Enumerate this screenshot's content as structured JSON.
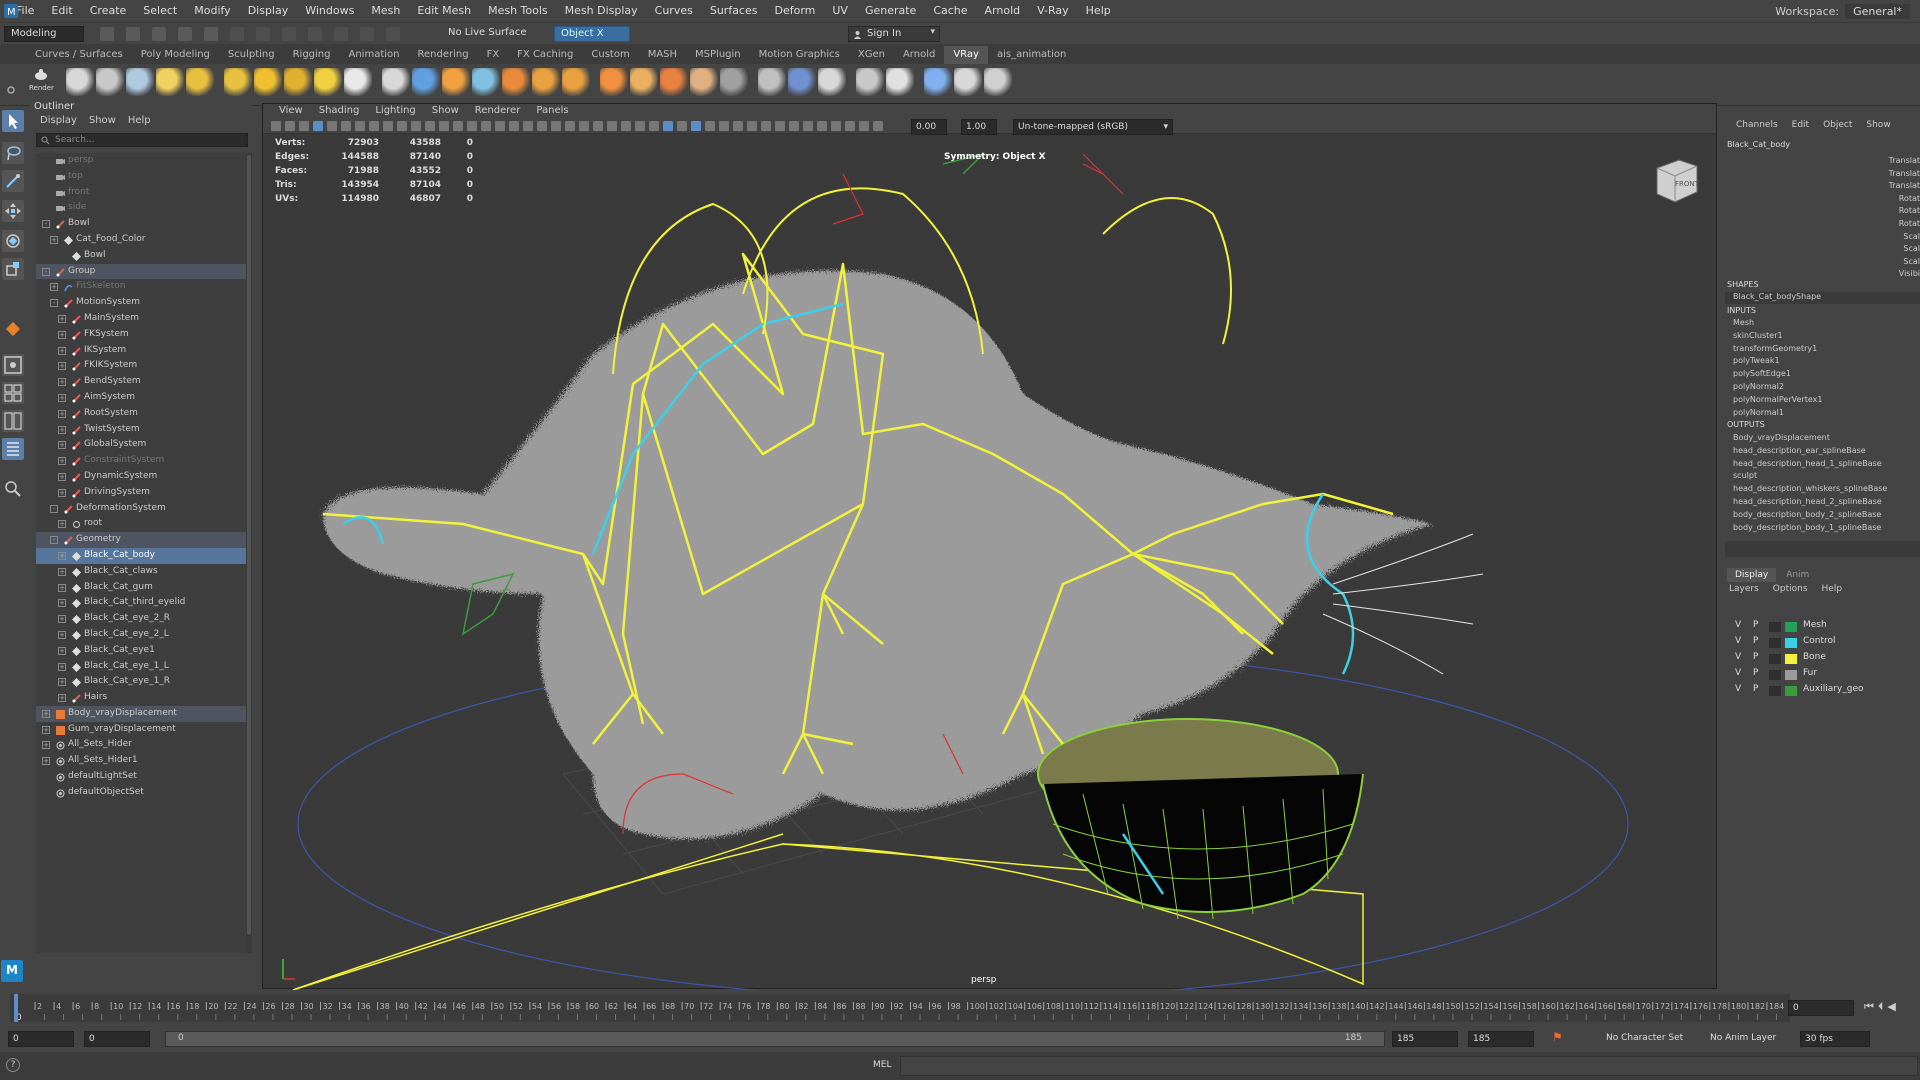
{
  "menubar": {
    "items": [
      "File",
      "Edit",
      "Create",
      "Select",
      "Modify",
      "Display",
      "Windows",
      "Mesh",
      "Edit Mesh",
      "Mesh Tools",
      "Mesh Display",
      "Curves",
      "Surfaces",
      "Deform",
      "UV",
      "Generate",
      "Cache",
      "Arnold",
      "V-Ray",
      "Help"
    ],
    "workspace_label": "Workspace:",
    "workspace_value": "General*"
  },
  "statusline": {
    "mode": "Modeling",
    "live_surface": "No Live Surface",
    "symmetry": "Object X",
    "sign_in": "Sign In"
  },
  "shelf": {
    "tabs": [
      "Curves / Surfaces",
      "Poly Modeling",
      "Sculpting",
      "Rigging",
      "Animation",
      "Rendering",
      "FX",
      "FX Caching",
      "Custom",
      "MASH",
      "MSPlugin",
      "Motion Graphics",
      "XGen",
      "Arnold",
      "VRay",
      "ais_animation"
    ],
    "active_tab": "VRay",
    "render_label": "Render"
  },
  "colors": {
    "selection": "#56779b",
    "mesh": "#23a05a",
    "control": "#3bd0e8",
    "bone": "#f2f23c",
    "fur": "#9b9b9b",
    "auxiliary": "#3c9b3c"
  },
  "outliner": {
    "title": "Outliner",
    "menu": [
      "Display",
      "Show",
      "Help"
    ],
    "search_placeholder": "Search...",
    "rows": [
      {
        "label": "persp",
        "depth": 1,
        "icon": "camera-icon",
        "dim": true
      },
      {
        "label": "top",
        "depth": 1,
        "icon": "camera-icon",
        "dim": true
      },
      {
        "label": "front",
        "depth": 1,
        "icon": "camera-icon",
        "dim": true
      },
      {
        "label": "side",
        "depth": 1,
        "icon": "camera-icon",
        "dim": true
      },
      {
        "label": "Bowl",
        "depth": 1,
        "icon": "joint-icon",
        "exp": "-"
      },
      {
        "label": "Cat_Food_Color",
        "depth": 2,
        "icon": "mesh-icon",
        "exp": "+"
      },
      {
        "label": "Bowl",
        "depth": 3,
        "icon": "mesh-icon"
      },
      {
        "label": "Group",
        "depth": 1,
        "icon": "joint-icon",
        "exp": "-",
        "grp": true
      },
      {
        "label": "FitSkeleton",
        "depth": 2,
        "icon": "curve-icon",
        "exp": "+",
        "dim": true
      },
      {
        "label": "MotionSystem",
        "depth": 2,
        "icon": "joint-icon",
        "exp": "-"
      },
      {
        "label": "MainSystem",
        "depth": 3,
        "icon": "joint-icon",
        "exp": "+"
      },
      {
        "label": "FKSystem",
        "depth": 3,
        "icon": "joint-icon",
        "exp": "+"
      },
      {
        "label": "IKSystem",
        "depth": 3,
        "icon": "joint-icon",
        "exp": "+"
      },
      {
        "label": "FKIKSystem",
        "depth": 3,
        "icon": "joint-icon",
        "exp": "+"
      },
      {
        "label": "BendSystem",
        "depth": 3,
        "icon": "joint-icon",
        "exp": "+"
      },
      {
        "label": "AimSystem",
        "depth": 3,
        "icon": "joint-icon",
        "exp": "+"
      },
      {
        "label": "RootSystem",
        "depth": 3,
        "icon": "joint-icon",
        "exp": "+"
      },
      {
        "label": "TwistSystem",
        "depth": 3,
        "icon": "joint-icon",
        "exp": "+"
      },
      {
        "label": "GlobalSystem",
        "depth": 3,
        "icon": "joint-icon",
        "exp": "+"
      },
      {
        "label": "ConstraintSystem",
        "depth": 3,
        "icon": "joint-icon",
        "exp": "+",
        "dim": true
      },
      {
        "label": "DynamicSystem",
        "depth": 3,
        "icon": "joint-icon",
        "exp": "+"
      },
      {
        "label": "DrivingSystem",
        "depth": 3,
        "icon": "joint-icon",
        "exp": "+"
      },
      {
        "label": "DeformationSystem",
        "depth": 2,
        "icon": "joint-icon",
        "exp": "-"
      },
      {
        "label": "root",
        "depth": 3,
        "icon": "bone-icon",
        "exp": "+"
      },
      {
        "label": "Geometry",
        "depth": 2,
        "icon": "joint-icon",
        "exp": "-",
        "grp": true
      },
      {
        "label": "Black_Cat_body",
        "depth": 3,
        "icon": "mesh-icon",
        "exp": "+",
        "sel": true
      },
      {
        "label": "Black_Cat_claws",
        "depth": 3,
        "icon": "mesh-icon",
        "exp": "+"
      },
      {
        "label": "Black_Cat_gum",
        "depth": 3,
        "icon": "mesh-icon",
        "exp": "+"
      },
      {
        "label": "Black_Cat_third_eyelid",
        "depth": 3,
        "icon": "mesh-icon",
        "exp": "+"
      },
      {
        "label": "Black_Cat_eye_2_R",
        "depth": 3,
        "icon": "mesh-icon",
        "exp": "+"
      },
      {
        "label": "Black_Cat_eye_2_L",
        "depth": 3,
        "icon": "mesh-icon",
        "exp": "+"
      },
      {
        "label": "Black_Cat_eye1",
        "depth": 3,
        "icon": "mesh-icon",
        "exp": "+"
      },
      {
        "label": "Black_Cat_eye_1_L",
        "depth": 3,
        "icon": "mesh-icon",
        "exp": "+"
      },
      {
        "label": "Black_Cat_eye_1_R",
        "depth": 3,
        "icon": "mesh-icon",
        "exp": "+"
      },
      {
        "label": "Hairs",
        "depth": 3,
        "icon": "joint-icon",
        "exp": "+"
      },
      {
        "label": "Body_vrayDisplacement",
        "depth": 1,
        "icon": "vray-icon",
        "exp": "+",
        "grp": true
      },
      {
        "label": "Gum_vrayDisplacement",
        "depth": 1,
        "icon": "vray-icon",
        "exp": "+"
      },
      {
        "label": "All_Sets_Hider",
        "depth": 1,
        "icon": "set-icon",
        "exp": "+"
      },
      {
        "label": "All_Sets_Hider1",
        "depth": 1,
        "icon": "set-icon",
        "exp": "+"
      },
      {
        "label": "defaultLightSet",
        "depth": 1,
        "icon": "set-icon"
      },
      {
        "label": "defaultObjectSet",
        "depth": 1,
        "icon": "set-icon"
      }
    ]
  },
  "viewport": {
    "menu": [
      "View",
      "Shading",
      "Lighting",
      "Show",
      "Renderer",
      "Panels"
    ],
    "exposure": "0.00",
    "gamma": "1.00",
    "colorspace": "Un-tone-mapped (sRGB)",
    "hud": [
      {
        "label": "Verts:",
        "a": "72903",
        "b": "43588",
        "c": "0"
      },
      {
        "label": "Edges:",
        "a": "144588",
        "b": "87140",
        "c": "0"
      },
      {
        "label": "Faces:",
        "a": "71988",
        "b": "43552",
        "c": "0"
      },
      {
        "label": "Tris:",
        "a": "143954",
        "b": "87104",
        "c": "0"
      },
      {
        "label": "UVs:",
        "a": "114980",
        "b": "46807",
        "c": "0"
      }
    ],
    "symmetry_text": "Symmetry: Object X",
    "camera": "persp",
    "viewcube_label": "FRONT"
  },
  "channelbox": {
    "menu": [
      "Channels",
      "Edit",
      "Object",
      "Show"
    ],
    "object_name": "Black_Cat_body",
    "attributes": [
      "Translat",
      "Translat",
      "Translat",
      "Rotat",
      "Rotat",
      "Rotat",
      "Scal",
      "Scal",
      "Scal",
      "Visibi"
    ],
    "shapes_header": "SHAPES",
    "shape": "Black_Cat_bodyShape",
    "inputs_header": "INPUTS",
    "inputs": [
      "Mesh",
      "skinCluster1",
      "transformGeometry1",
      "polyTweak1",
      "polySoftEdge1",
      "polyNormal2",
      "polyNormalPerVertex1",
      "polyNormal1"
    ],
    "outputs_header": "OUTPUTS",
    "outputs": [
      "Body_vrayDisplacement",
      "head_description_ear_splineBase",
      "head_description_head_1_splineBase",
      "sculpt",
      "head_description_whiskers_splineBase",
      "head_description_head_2_splineBase",
      "body_description_body_2_splineBase",
      "body_description_body_1_splineBase"
    ]
  },
  "layers": {
    "tabs": [
      "Display",
      "Anim"
    ],
    "menu": [
      "Layers",
      "Options",
      "Help"
    ],
    "rows": [
      {
        "v": "V",
        "p": "P",
        "name": "Mesh",
        "color": "#23a05a"
      },
      {
        "v": "V",
        "p": "P",
        "name": "Control",
        "color": "#3bd0e8"
      },
      {
        "v": "V",
        "p": "P",
        "name": "Bone",
        "color": "#f2f23c"
      },
      {
        "v": "V",
        "p": "P",
        "name": "Fur",
        "color": "#9b9b9b"
      },
      {
        "v": "V",
        "p": "P",
        "name": "Auxiliary_geo",
        "color": "#3c9b3c"
      }
    ]
  },
  "timeline": {
    "ticks": [
      "2",
      "4",
      "6",
      "8",
      "10",
      "12",
      "14",
      "16",
      "18",
      "20",
      "22",
      "24",
      "26",
      "28",
      "30",
      "32",
      "34",
      "36",
      "38",
      "40",
      "42",
      "44",
      "46",
      "48",
      "50",
      "52",
      "54",
      "56",
      "58",
      "60",
      "62",
      "64",
      "66",
      "68",
      "70",
      "72",
      "74",
      "76",
      "78",
      "80",
      "82",
      "84",
      "86",
      "88",
      "90",
      "92",
      "94",
      "96",
      "98",
      "100",
      "102",
      "104",
      "106",
      "108",
      "110",
      "112",
      "114",
      "116",
      "118",
      "120",
      "122",
      "124",
      "126",
      "128",
      "130",
      "132",
      "134",
      "136",
      "138",
      "140",
      "142",
      "144",
      "146",
      "148",
      "150",
      "152",
      "154",
      "156",
      "158",
      "160",
      "162",
      "164",
      "166",
      "168",
      "170",
      "172",
      "174",
      "176",
      "178",
      "180",
      "182",
      "184"
    ],
    "current_frame": "0",
    "start_label": "0"
  },
  "range": {
    "start": "0",
    "anim_start": "0",
    "slider_start": "0",
    "slider_end": "185",
    "end": "185",
    "anim_end": "185",
    "character_set": "No Character Set",
    "anim_layer": "No Anim Layer",
    "fps": "30 fps"
  },
  "cmdline": {
    "lang": "MEL"
  }
}
